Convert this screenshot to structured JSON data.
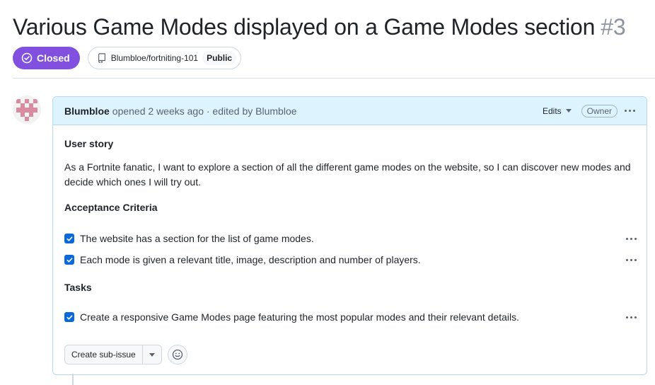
{
  "issue": {
    "title": "Various Game Modes displayed on a Game Modes section",
    "number": "#3",
    "state": "Closed",
    "repo": "Blumbloe/fortniting-101",
    "visibility": "Public"
  },
  "comment": {
    "author": "Blumbloe",
    "opened_text": "opened 2 weeks ago · edited by Blumbloe",
    "edits_label": "Edits",
    "role_badge": "Owner",
    "user_story_heading": "User story",
    "user_story_text": "As a Fortnite fanatic, I want to explore a section of all the different game modes on the website, so I can discover new modes and decide which ones I will try out.",
    "acceptance_heading": "Acceptance Criteria",
    "acceptance_items": [
      "The website has a section for the list of game modes.",
      "Each mode is given a relevant title, image, description and number of players."
    ],
    "tasks_heading": "Tasks",
    "task_items": [
      "Create a responsive Game Modes page featuring the most popular modes and their relevant details."
    ],
    "create_sub_issue_label": "Create sub-issue"
  },
  "colors": {
    "closed_purple": "#8250df",
    "checkbox_blue": "#0969da",
    "header_blue": "#ddf4ff"
  }
}
